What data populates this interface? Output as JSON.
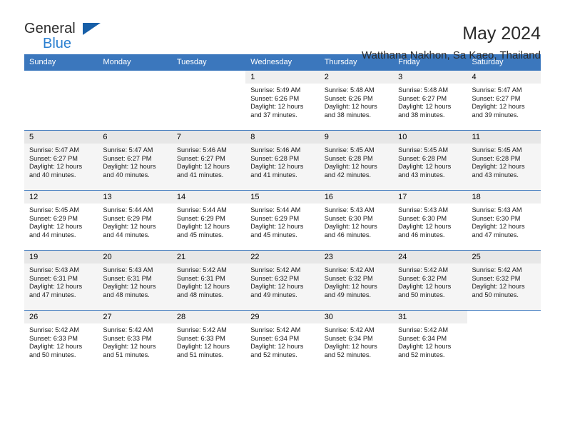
{
  "brand": {
    "line1": "General",
    "line2": "Blue",
    "triangle_color": "#175fa8",
    "blue_color": "#2a7fd0"
  },
  "header": {
    "title": "May 2024",
    "subtitle": "Watthana Nakhon, Sa Kaeo, Thailand",
    "accent_color": "#3b77bd"
  },
  "weekdays": [
    "Sunday",
    "Monday",
    "Tuesday",
    "Wednesday",
    "Thursday",
    "Friday",
    "Saturday"
  ],
  "weeks": [
    [
      {
        "day": "",
        "empty": true
      },
      {
        "day": "",
        "empty": true
      },
      {
        "day": "",
        "empty": true
      },
      {
        "day": "1",
        "sunrise": "Sunrise: 5:49 AM",
        "sunset": "Sunset: 6:26 PM",
        "daylight1": "Daylight: 12 hours",
        "daylight2": "and 37 minutes."
      },
      {
        "day": "2",
        "sunrise": "Sunrise: 5:48 AM",
        "sunset": "Sunset: 6:26 PM",
        "daylight1": "Daylight: 12 hours",
        "daylight2": "and 38 minutes."
      },
      {
        "day": "3",
        "sunrise": "Sunrise: 5:48 AM",
        "sunset": "Sunset: 6:27 PM",
        "daylight1": "Daylight: 12 hours",
        "daylight2": "and 38 minutes."
      },
      {
        "day": "4",
        "sunrise": "Sunrise: 5:47 AM",
        "sunset": "Sunset: 6:27 PM",
        "daylight1": "Daylight: 12 hours",
        "daylight2": "and 39 minutes."
      }
    ],
    [
      {
        "day": "5",
        "sunrise": "Sunrise: 5:47 AM",
        "sunset": "Sunset: 6:27 PM",
        "daylight1": "Daylight: 12 hours",
        "daylight2": "and 40 minutes."
      },
      {
        "day": "6",
        "sunrise": "Sunrise: 5:47 AM",
        "sunset": "Sunset: 6:27 PM",
        "daylight1": "Daylight: 12 hours",
        "daylight2": "and 40 minutes."
      },
      {
        "day": "7",
        "sunrise": "Sunrise: 5:46 AM",
        "sunset": "Sunset: 6:27 PM",
        "daylight1": "Daylight: 12 hours",
        "daylight2": "and 41 minutes."
      },
      {
        "day": "8",
        "sunrise": "Sunrise: 5:46 AM",
        "sunset": "Sunset: 6:28 PM",
        "daylight1": "Daylight: 12 hours",
        "daylight2": "and 41 minutes."
      },
      {
        "day": "9",
        "sunrise": "Sunrise: 5:45 AM",
        "sunset": "Sunset: 6:28 PM",
        "daylight1": "Daylight: 12 hours",
        "daylight2": "and 42 minutes."
      },
      {
        "day": "10",
        "sunrise": "Sunrise: 5:45 AM",
        "sunset": "Sunset: 6:28 PM",
        "daylight1": "Daylight: 12 hours",
        "daylight2": "and 43 minutes."
      },
      {
        "day": "11",
        "sunrise": "Sunrise: 5:45 AM",
        "sunset": "Sunset: 6:28 PM",
        "daylight1": "Daylight: 12 hours",
        "daylight2": "and 43 minutes."
      }
    ],
    [
      {
        "day": "12",
        "sunrise": "Sunrise: 5:45 AM",
        "sunset": "Sunset: 6:29 PM",
        "daylight1": "Daylight: 12 hours",
        "daylight2": "and 44 minutes."
      },
      {
        "day": "13",
        "sunrise": "Sunrise: 5:44 AM",
        "sunset": "Sunset: 6:29 PM",
        "daylight1": "Daylight: 12 hours",
        "daylight2": "and 44 minutes."
      },
      {
        "day": "14",
        "sunrise": "Sunrise: 5:44 AM",
        "sunset": "Sunset: 6:29 PM",
        "daylight1": "Daylight: 12 hours",
        "daylight2": "and 45 minutes."
      },
      {
        "day": "15",
        "sunrise": "Sunrise: 5:44 AM",
        "sunset": "Sunset: 6:29 PM",
        "daylight1": "Daylight: 12 hours",
        "daylight2": "and 45 minutes."
      },
      {
        "day": "16",
        "sunrise": "Sunrise: 5:43 AM",
        "sunset": "Sunset: 6:30 PM",
        "daylight1": "Daylight: 12 hours",
        "daylight2": "and 46 minutes."
      },
      {
        "day": "17",
        "sunrise": "Sunrise: 5:43 AM",
        "sunset": "Sunset: 6:30 PM",
        "daylight1": "Daylight: 12 hours",
        "daylight2": "and 46 minutes."
      },
      {
        "day": "18",
        "sunrise": "Sunrise: 5:43 AM",
        "sunset": "Sunset: 6:30 PM",
        "daylight1": "Daylight: 12 hours",
        "daylight2": "and 47 minutes."
      }
    ],
    [
      {
        "day": "19",
        "sunrise": "Sunrise: 5:43 AM",
        "sunset": "Sunset: 6:31 PM",
        "daylight1": "Daylight: 12 hours",
        "daylight2": "and 47 minutes."
      },
      {
        "day": "20",
        "sunrise": "Sunrise: 5:43 AM",
        "sunset": "Sunset: 6:31 PM",
        "daylight1": "Daylight: 12 hours",
        "daylight2": "and 48 minutes."
      },
      {
        "day": "21",
        "sunrise": "Sunrise: 5:42 AM",
        "sunset": "Sunset: 6:31 PM",
        "daylight1": "Daylight: 12 hours",
        "daylight2": "and 48 minutes."
      },
      {
        "day": "22",
        "sunrise": "Sunrise: 5:42 AM",
        "sunset": "Sunset: 6:32 PM",
        "daylight1": "Daylight: 12 hours",
        "daylight2": "and 49 minutes."
      },
      {
        "day": "23",
        "sunrise": "Sunrise: 5:42 AM",
        "sunset": "Sunset: 6:32 PM",
        "daylight1": "Daylight: 12 hours",
        "daylight2": "and 49 minutes."
      },
      {
        "day": "24",
        "sunrise": "Sunrise: 5:42 AM",
        "sunset": "Sunset: 6:32 PM",
        "daylight1": "Daylight: 12 hours",
        "daylight2": "and 50 minutes."
      },
      {
        "day": "25",
        "sunrise": "Sunrise: 5:42 AM",
        "sunset": "Sunset: 6:32 PM",
        "daylight1": "Daylight: 12 hours",
        "daylight2": "and 50 minutes."
      }
    ],
    [
      {
        "day": "26",
        "sunrise": "Sunrise: 5:42 AM",
        "sunset": "Sunset: 6:33 PM",
        "daylight1": "Daylight: 12 hours",
        "daylight2": "and 50 minutes."
      },
      {
        "day": "27",
        "sunrise": "Sunrise: 5:42 AM",
        "sunset": "Sunset: 6:33 PM",
        "daylight1": "Daylight: 12 hours",
        "daylight2": "and 51 minutes."
      },
      {
        "day": "28",
        "sunrise": "Sunrise: 5:42 AM",
        "sunset": "Sunset: 6:33 PM",
        "daylight1": "Daylight: 12 hours",
        "daylight2": "and 51 minutes."
      },
      {
        "day": "29",
        "sunrise": "Sunrise: 5:42 AM",
        "sunset": "Sunset: 6:34 PM",
        "daylight1": "Daylight: 12 hours",
        "daylight2": "and 52 minutes."
      },
      {
        "day": "30",
        "sunrise": "Sunrise: 5:42 AM",
        "sunset": "Sunset: 6:34 PM",
        "daylight1": "Daylight: 12 hours",
        "daylight2": "and 52 minutes."
      },
      {
        "day": "31",
        "sunrise": "Sunrise: 5:42 AM",
        "sunset": "Sunset: 6:34 PM",
        "daylight1": "Daylight: 12 hours",
        "daylight2": "and 52 minutes."
      },
      {
        "day": "",
        "empty": true
      }
    ]
  ]
}
